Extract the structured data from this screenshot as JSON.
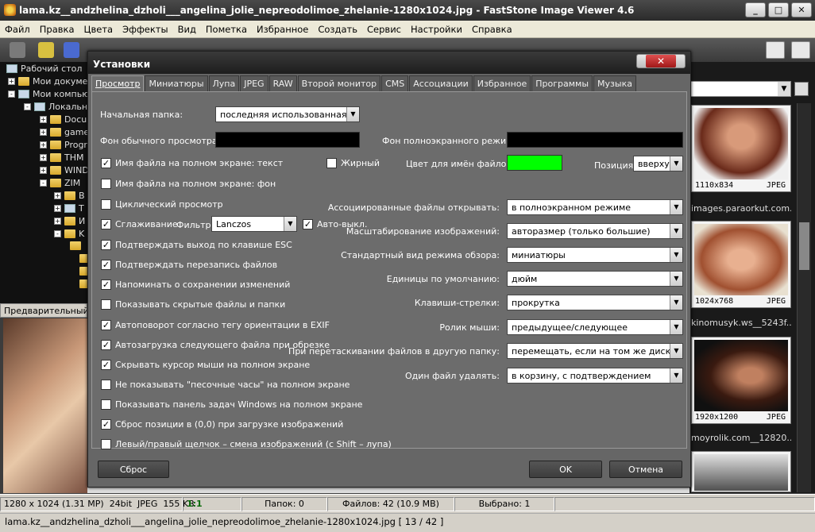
{
  "app": {
    "title": "lama.kz__andzhelina_dzholi___angelina_jolie_nepreodolimoe_zhelanie-1280x1024.jpg - FastStone Image Viewer 4.6",
    "win_min": "_",
    "win_max": "□",
    "win_close": "✕"
  },
  "menu": [
    "Файл",
    "Правка",
    "Цвета",
    "Эффекты",
    "Вид",
    "Пометка",
    "Избранное",
    "Создать",
    "Сервис",
    "Настройки",
    "Справка"
  ],
  "tree": {
    "desktop": "Рабочий стол",
    "mydocs": "Мои докумен",
    "mycomputer": "Мои компьют",
    "localdisk": "Локальны",
    "f1": "Docu",
    "f2": "game",
    "f3": "Progr",
    "f4": "THM",
    "f5": "WIND",
    "f6": "ZIM",
    "f7": "B",
    "f8": "T",
    "f9": "И",
    "f10": "K"
  },
  "preview_header": "Предварительный п",
  "thumbs": [
    {
      "dims": "1110x834",
      "fmt": "JPEG",
      "name": "images.paraorkut.com..."
    },
    {
      "dims": "1024x768",
      "fmt": "JPEG",
      "name": "kinomusyk.ws__5243f..."
    },
    {
      "dims": "1920x1200",
      "fmt": "JPEG",
      "name": "moyrolik.com__12820..."
    }
  ],
  "status": {
    "dims": "1280 x 1024 (1.31 MP)",
    "bits": "24bit",
    "fmt": "JPEG",
    "size": "155 KB",
    "zoom": "1:1",
    "folders": "Папок: 0",
    "files": "Файлов: 42 (10.9 MB)",
    "selected": "Выбрано: 1"
  },
  "path": "lama.kz__andzhelina_dzholi___angelina_jolie_nepreodolimoe_zhelanie-1280x1024.jpg [ 13 / 42 ]",
  "dialog": {
    "title": "Установки",
    "close": "✕",
    "tabs": [
      "Просмотр",
      "Миниатюры",
      "Лупа",
      "JPEG",
      "RAW",
      "Второй монитор",
      "CMS",
      "Ассоциации",
      "Избранное",
      "Программы",
      "Музыка"
    ],
    "start_folder_label": "Начальная папка:",
    "start_folder_value": "последняя использованная",
    "bg_normal_label": "Фон обычного просмотра:",
    "bg_fullscreen_label": "Фон полноэкранного режима:",
    "bg_normal_color": "#000000",
    "bg_fullscreen_color": "#000000",
    "filename_color_label": "Цвет для имён файлов:",
    "filename_color": "#00ff00",
    "bold_label": "Жирный",
    "position_label": "Позиция:",
    "position_value": "вверху",
    "filter_label": "Фильтр:",
    "filter_value": "Lanczos",
    "auto_off_label": "Авто-выкл.",
    "checkboxes": [
      {
        "label": "Имя файла на полном экране: текст",
        "checked": true
      },
      {
        "label": "Имя файла на полном экране: фон",
        "checked": false
      },
      {
        "label": "Циклический просмотр",
        "checked": false
      },
      {
        "label": "Сглаживание",
        "checked": true
      },
      {
        "label": "Подтверждать выход по клавише ESC",
        "checked": true
      },
      {
        "label": "Подтверждать перезапись файлов",
        "checked": true
      },
      {
        "label": "Напоминать о сохранении изменений",
        "checked": true
      },
      {
        "label": "Показывать скрытые файлы и папки",
        "checked": false
      },
      {
        "label": "Автоповорот согласно тегу ориентации в EXIF",
        "checked": true
      },
      {
        "label": "Автозагрузка следующего файла при обрезке",
        "checked": true
      },
      {
        "label": "Скрывать курсор мыши на полном экране",
        "checked": true
      },
      {
        "label": "Не показывать \"песочные часы\" на полном экране",
        "checked": false
      },
      {
        "label": "Показывать панель задач Windows на полном экране",
        "checked": false
      },
      {
        "label": "Сброс позиции в (0,0) при загрузке изображений",
        "checked": true
      },
      {
        "label": "Левый/правый щелчок – смена изображений (с Shift – лупа)",
        "checked": false
      }
    ],
    "bold_checked": false,
    "auto_off_checked": true,
    "right_settings": [
      {
        "label": "Ассоциированные файлы открывать:",
        "value": "в полноэкранном режиме"
      },
      {
        "label": "Масштабирование изображений:",
        "value": "авторазмер (только большие)"
      },
      {
        "label": "Стандартный вид режима обзора:",
        "value": "миниатюры"
      },
      {
        "label": "Единицы по умолчанию:",
        "value": "дюйм"
      },
      {
        "label": "Клавиши-стрелки:",
        "value": "прокрутка"
      },
      {
        "label": "Ролик мыши:",
        "value": "предыдущее/следующее"
      },
      {
        "label": "При перетаскивании файлов в другую папку:",
        "value": "перемещать, если на том же диске"
      },
      {
        "label": "Один файл удалять:",
        "value": "в корзину, с подтверждением"
      }
    ],
    "reset": "Сброс",
    "ok": "OK",
    "cancel": "Отмена"
  },
  "colors": {
    "accent": "#00ff00",
    "dialog_bg": "#6c6c6c"
  }
}
